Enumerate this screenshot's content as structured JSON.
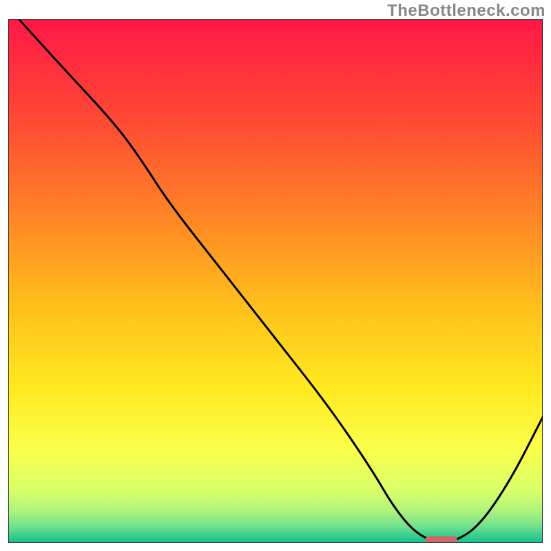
{
  "watermark": "TheBottleneck.com",
  "chart_data": {
    "type": "line",
    "title": "",
    "xlabel": "",
    "ylabel": "",
    "xlim": [
      0,
      100
    ],
    "ylim": [
      0,
      100
    ],
    "grid": false,
    "legend": null,
    "background_gradient_stops": [
      {
        "offset": 0.0,
        "color": "#ff1846"
      },
      {
        "offset": 0.2,
        "color": "#ff4b34"
      },
      {
        "offset": 0.4,
        "color": "#ff8d24"
      },
      {
        "offset": 0.55,
        "color": "#ffc01c"
      },
      {
        "offset": 0.7,
        "color": "#ffe81e"
      },
      {
        "offset": 0.82,
        "color": "#fbff4a"
      },
      {
        "offset": 0.9,
        "color": "#d8ff6a"
      },
      {
        "offset": 0.94,
        "color": "#aef37c"
      },
      {
        "offset": 0.97,
        "color": "#6fe08f"
      },
      {
        "offset": 0.985,
        "color": "#3ccf8e"
      },
      {
        "offset": 1.0,
        "color": "#14c08e"
      }
    ],
    "series": [
      {
        "name": "bottleneck-curve",
        "x": [
          2,
          10,
          20,
          25,
          30,
          40,
          50,
          60,
          68,
          72,
          76,
          80,
          83,
          88,
          94,
          100
        ],
        "y": [
          100,
          91,
          80,
          73,
          65,
          52,
          39,
          26,
          14,
          7,
          2,
          0,
          0,
          3,
          12,
          24
        ]
      }
    ],
    "marker": {
      "name": "optimal-range",
      "x_center": 81,
      "y": 0.5,
      "width": 6,
      "height": 1.6,
      "color": "#cc6a6a"
    },
    "axes_border_color": "#000000",
    "axes_border_width": 1.5
  }
}
